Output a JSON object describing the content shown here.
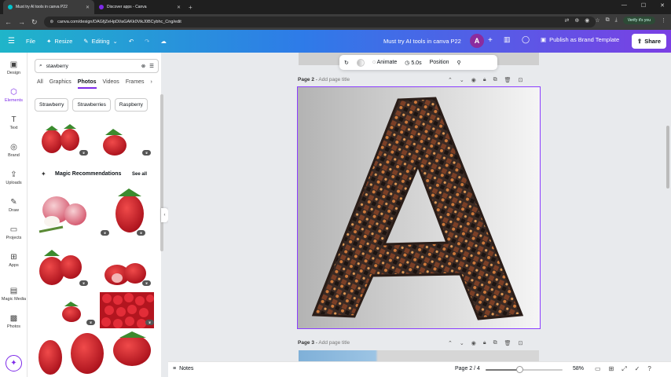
{
  "browser": {
    "tabs": [
      {
        "label": "Must try AI tools in canva P22",
        "active": true
      },
      {
        "label": "Discover apps - Canva",
        "active": false
      }
    ],
    "url": "canva.com/design/DAGfjZeHpDI/aGAKk0VikJ0BCybhc_Cng/edit",
    "verify_label": "Verify it's you"
  },
  "topbar": {
    "file": "File",
    "resize": "Resize",
    "editing": "Editing",
    "doc_title": "Must try AI tools in canva P22",
    "avatar_letter": "A",
    "publish": "Publish as Brand Template",
    "share": "Share"
  },
  "rail": [
    {
      "label": "Design",
      "icon": "▣"
    },
    {
      "label": "Elements",
      "icon": "⬡"
    },
    {
      "label": "Text",
      "icon": "T"
    },
    {
      "label": "Brand",
      "icon": "◎"
    },
    {
      "label": "Uploads",
      "icon": "⇪"
    },
    {
      "label": "Draw",
      "icon": "✎"
    },
    {
      "label": "Projects",
      "icon": "▭"
    },
    {
      "label": "Apps",
      "icon": "⊞"
    },
    {
      "label": "Magic Media",
      "icon": "▤"
    },
    {
      "label": "Photos",
      "icon": "▩"
    }
  ],
  "panel": {
    "search_value": "stawberry",
    "tabs": [
      "All",
      "Graphics",
      "Photos",
      "Videos",
      "Frames"
    ],
    "active_tab": "Photos",
    "chips": [
      "Strawberry",
      "Strawberries",
      "Raspberry"
    ],
    "magic_title": "Magic Recommendations",
    "see_all": "See all"
  },
  "page_toolbar": {
    "animate": "Animate",
    "duration": "5.0s",
    "position": "Position"
  },
  "pages": {
    "page2_label": "Page 2",
    "page2_add": "Add page title",
    "page3_label": "Page 3",
    "page3_add": "Add page title"
  },
  "bottombar": {
    "notes": "Notes",
    "page_count": "Page 2 / 4",
    "zoom": "58%",
    "zoom_fraction": 0.44
  },
  "colors": {
    "accent": "#7d2ae8",
    "topbar_start": "#1fb5c9",
    "topbar_end": "#7b3fe4",
    "strawberry": "#d6242f"
  }
}
